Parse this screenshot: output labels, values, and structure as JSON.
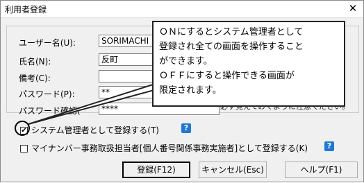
{
  "window": {
    "title": "利用者登録",
    "close_glyph": "✕"
  },
  "form": {
    "user_name_label": "ユーザー名(U):",
    "user_name_value": "SORIMACHI",
    "full_name_label": "氏名(N):",
    "full_name_value": "反町",
    "note_label": "備考(C):",
    "note_value": "",
    "password_label": "パスワード(P):",
    "password_value": "**",
    "password_confirm_label": "パスワード確認(",
    "password_confirm_value": "****",
    "hidden_note_fragment": "必ず覚えておくように注意ください。"
  },
  "options": {
    "admin_label": "システム管理者として登録する(T)",
    "admin_checked": true,
    "admin_check_glyph": "✔",
    "mynumber_label": "マイナンバー事務取扱担当者[個人番号関係事務実施者]として登録する(K)",
    "mynumber_checked": false,
    "help_glyph": "?"
  },
  "callout": {
    "lines": [
      "ＯＮにするとシステム管理者として",
      "登録され全ての画面を操作すること",
      "ができます。",
      "ＯＦＦにすると操作できる画面が",
      "限定されます。"
    ]
  },
  "buttons": {
    "register": "登録(F12)",
    "cancel": "キャンセル(Esc)",
    "help": "ヘルプ(F1)"
  }
}
